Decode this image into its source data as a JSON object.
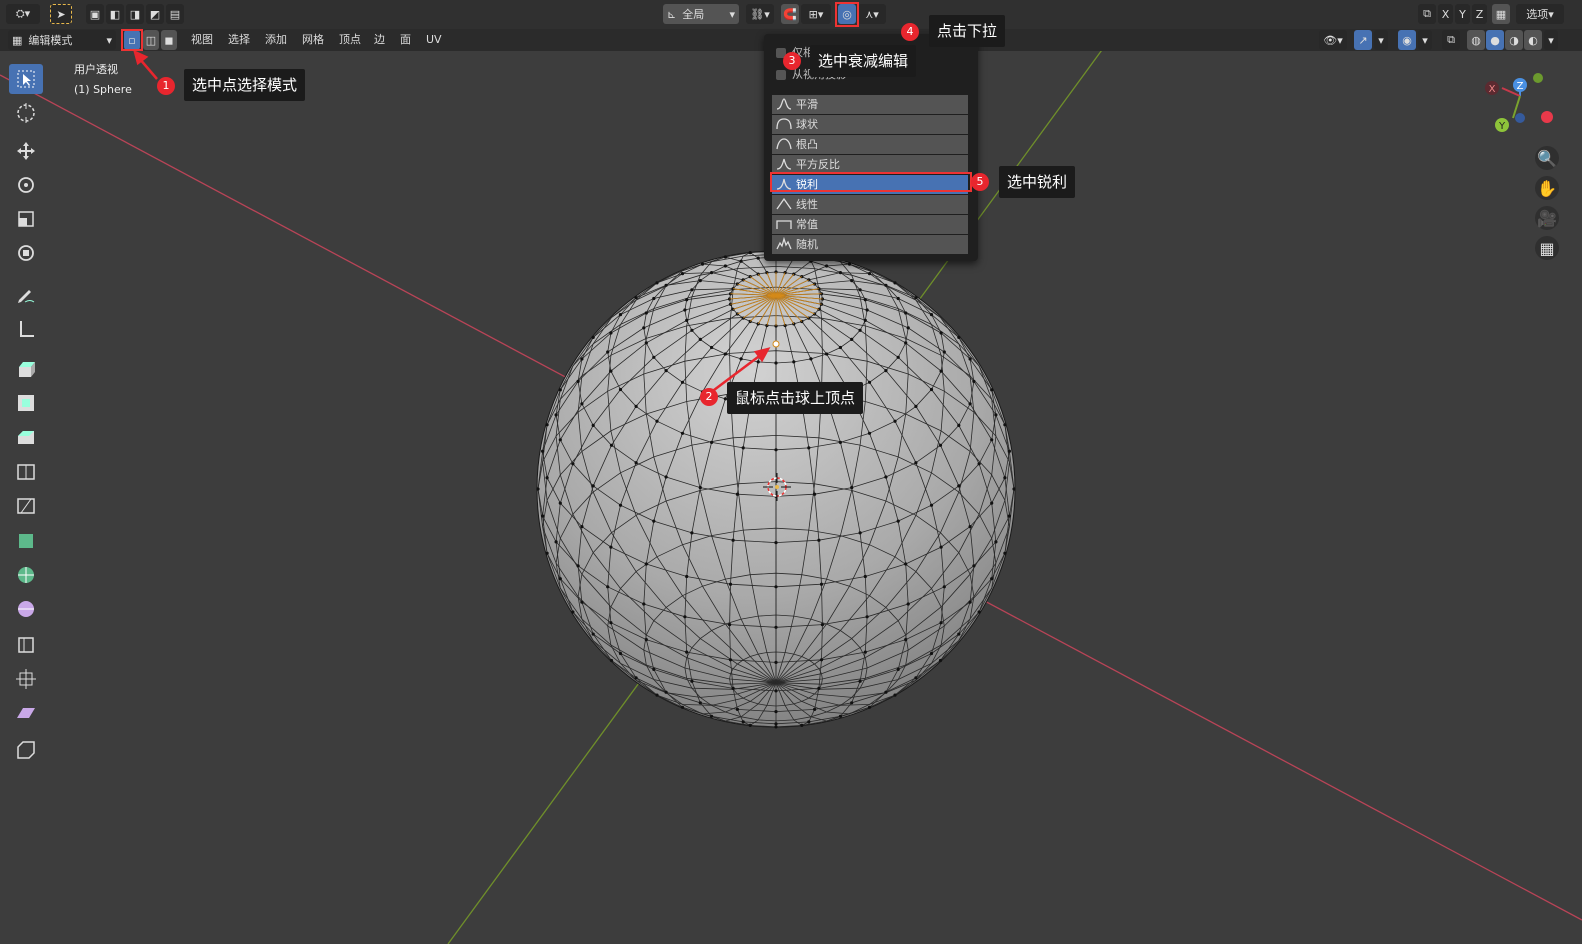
{
  "topbar": {
    "transform_orientation": "全局",
    "options_label": "选项",
    "axis_labels": [
      "X",
      "Y",
      "Z"
    ]
  },
  "header": {
    "mode": "编辑模式",
    "menus": [
      "视图",
      "选择",
      "添加",
      "网格",
      "顶点",
      "边",
      "面",
      "UV"
    ]
  },
  "viewport": {
    "view_name": "用户透视",
    "object_name": "(1) Sphere"
  },
  "falloff_dropdown": {
    "options_checks": [
      "仅相连项",
      "从视角投影"
    ],
    "items": [
      {
        "label": "平滑",
        "icon": "smooth-curve-icon"
      },
      {
        "label": "球状",
        "icon": "sphere-curve-icon"
      },
      {
        "label": "根凸",
        "icon": "root-curve-icon"
      },
      {
        "label": "平方反比",
        "icon": "inverse-square-curve-icon"
      },
      {
        "label": "锐利",
        "icon": "sharp-curve-icon",
        "selected": true
      },
      {
        "label": "线性",
        "icon": "linear-curve-icon"
      },
      {
        "label": "常值",
        "icon": "constant-curve-icon"
      },
      {
        "label": "随机",
        "icon": "random-curve-icon"
      }
    ]
  },
  "annotations": [
    {
      "number": "1",
      "text": "选中点选择模式"
    },
    {
      "number": "2",
      "text": "鼠标点击球上顶点"
    },
    {
      "number": "3",
      "text": "选中衰减编辑"
    },
    {
      "number": "4",
      "text": "点击下拉"
    },
    {
      "number": "5",
      "text": "选中锐利"
    }
  ],
  "gizmo": {
    "x": "X",
    "y": "Y",
    "z": "Z"
  },
  "colors": {
    "accent": "#4772b3",
    "annotation_red": "#e8262e",
    "x_axis": "#c8394a",
    "y_axis": "#7aa32e"
  }
}
